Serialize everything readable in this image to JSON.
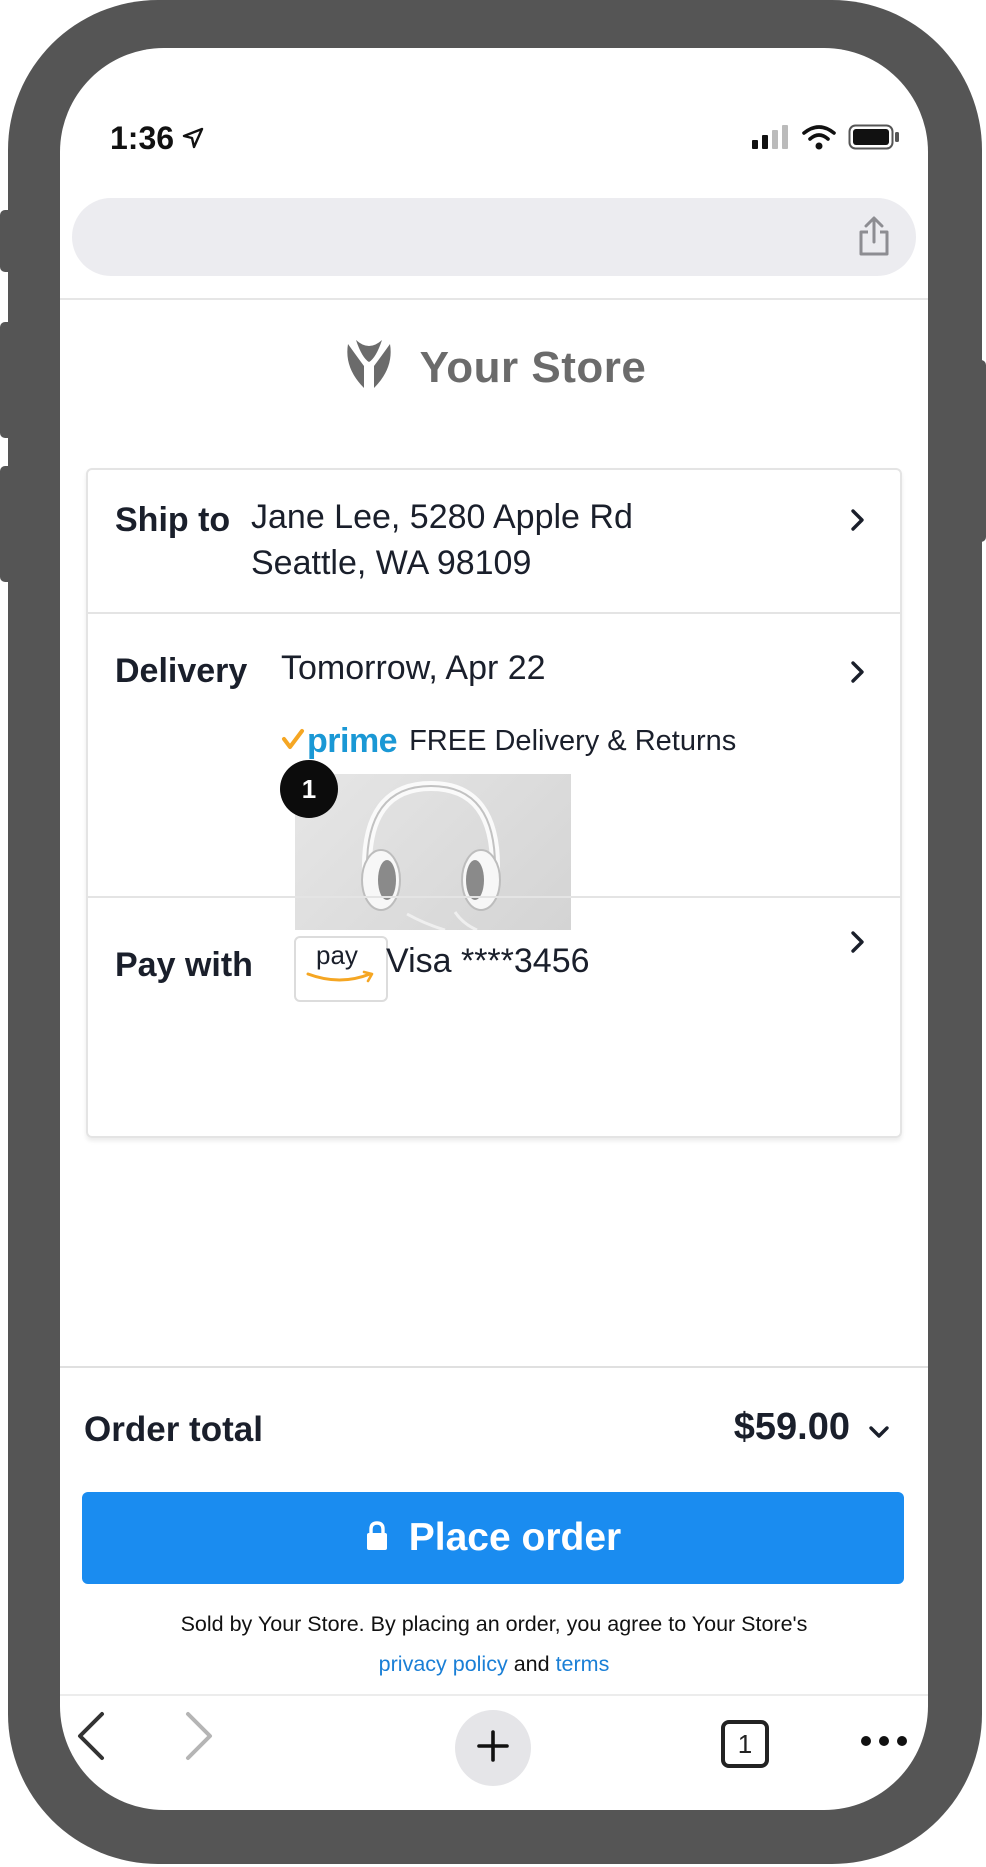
{
  "status_bar": {
    "time": "1:36"
  },
  "store": {
    "name": "Your Store"
  },
  "ship_to": {
    "label": "Ship to",
    "line1": "Jane Lee, 5280 Apple Rd",
    "line2": "Seattle, WA 98109"
  },
  "delivery": {
    "label": "Delivery",
    "date": "Tomorrow, Apr 22",
    "prime_label": "prime",
    "free_text": "FREE Delivery & Returns",
    "item_quantity": "1"
  },
  "payment": {
    "label": "Pay with",
    "pay_logo_text": "pay",
    "card": "Visa ****3456"
  },
  "order": {
    "total_label": "Order total",
    "total_value": "$59.00"
  },
  "place_order": {
    "label": "Place order"
  },
  "disclaimer": {
    "text": "Sold by Your Store. By placing an order, you agree to Your Store's",
    "privacy_link": "privacy policy",
    "and": "and",
    "terms_link": "terms"
  },
  "toolbar": {
    "tab_count": "1"
  },
  "colors": {
    "accent": "#1a8cf0",
    "prime_blue": "#1a98d5",
    "prime_check": "#f5a623",
    "link": "#1a7fd6",
    "frame": "#555555"
  }
}
